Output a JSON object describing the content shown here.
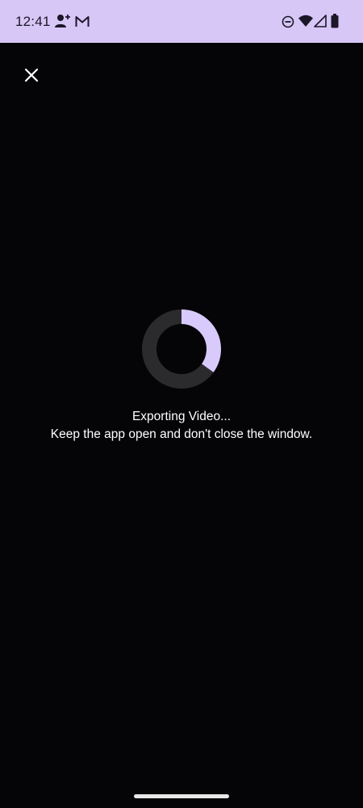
{
  "status_bar": {
    "time": "12:41",
    "background": "#d6c7f7",
    "left_icons": [
      "person-add-icon",
      "gmail-icon"
    ],
    "right_icons": [
      "do-not-disturb-icon",
      "wifi-icon",
      "cellular-signal-icon",
      "battery-icon"
    ]
  },
  "toolbar": {
    "close_icon": "close-icon"
  },
  "export": {
    "title": "Exporting Video...",
    "message": "Keep the app open and don't close the window.",
    "progress": 0.35,
    "progress_color": "#d8cbfb",
    "track_color": "#2b2a2d"
  }
}
